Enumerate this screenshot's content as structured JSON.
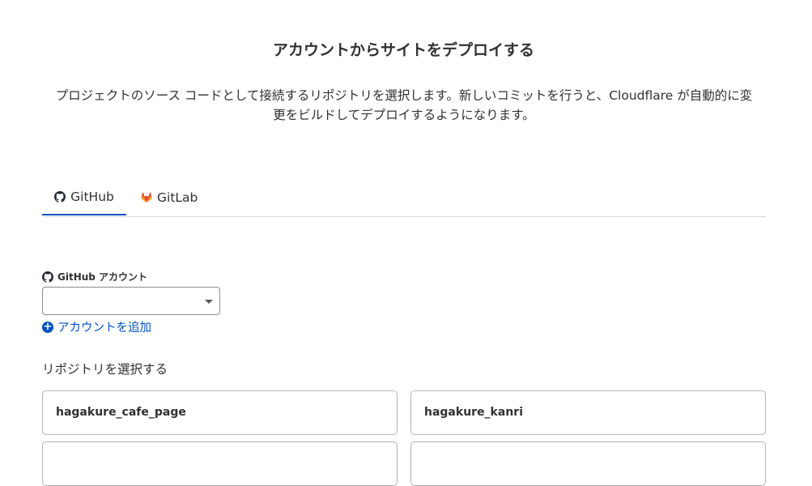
{
  "page": {
    "title": "アカウントからサイトをデプロイする",
    "description_line1": "プロジェクトのソース コードとして接続するリポジトリを選択します。新しいコミットを行うと、Cloudflare が自動的に変",
    "description_line2": "更をビルドしてデプロイするようになります。"
  },
  "tabs": [
    {
      "label": "GitHub",
      "icon": "github-icon",
      "active": true
    },
    {
      "label": "GitLab",
      "icon": "gitlab-icon",
      "active": false
    }
  ],
  "account": {
    "label": "GitHub アカウント",
    "selected_value": "",
    "add_label": "アカウントを追加"
  },
  "repositories": {
    "label": "リポジトリを選択する",
    "items": [
      {
        "name": "hagakure_cafe_page"
      },
      {
        "name": "hagakure_kanri"
      },
      {
        "name": ""
      },
      {
        "name": ""
      }
    ]
  },
  "colors": {
    "accent": "#0051c3",
    "text": "#313131",
    "border": "#b3b3b3",
    "gitlab_orange": "#e24329"
  }
}
